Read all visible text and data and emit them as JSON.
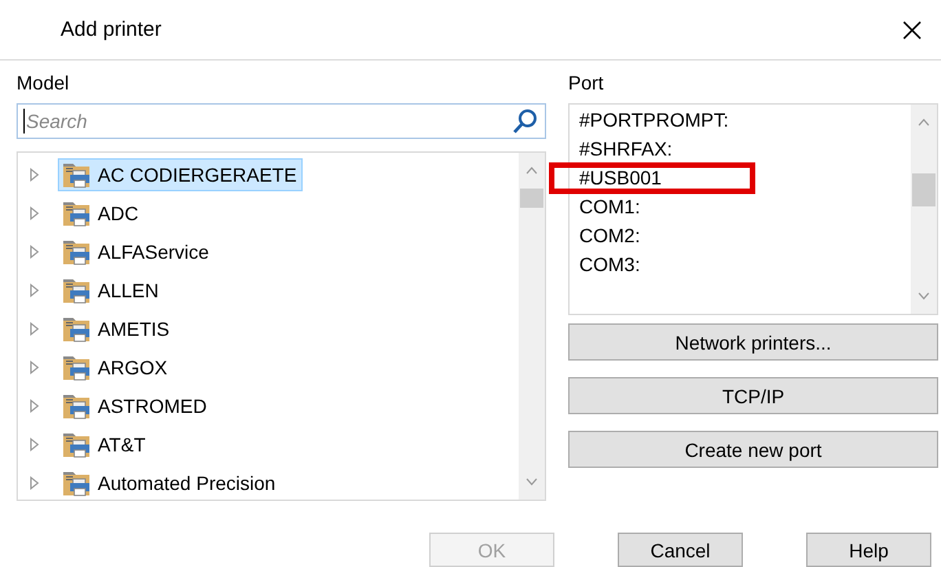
{
  "window": {
    "title": "Add printer"
  },
  "model": {
    "label": "Model",
    "search": {
      "placeholder": "Search"
    },
    "items": [
      {
        "label": "AC CODIERGERAETE",
        "selected": true,
        "expanded": false
      },
      {
        "label": "ADC",
        "selected": false,
        "expanded": false
      },
      {
        "label": "ALFAService",
        "selected": false,
        "expanded": false
      },
      {
        "label": "ALLEN",
        "selected": false,
        "expanded": false
      },
      {
        "label": "AMETIS",
        "selected": false,
        "expanded": false
      },
      {
        "label": "ARGOX",
        "selected": false,
        "expanded": false
      },
      {
        "label": "ASTROMED",
        "selected": false,
        "expanded": false
      },
      {
        "label": "AT&T",
        "selected": false,
        "expanded": false
      },
      {
        "label": "Automated Precision",
        "selected": false,
        "expanded": false
      }
    ]
  },
  "port": {
    "label": "Port",
    "items": [
      {
        "label": "#PORTPROMPT:",
        "highlighted": false
      },
      {
        "label": "#SHRFAX:",
        "highlighted": false
      },
      {
        "label": "#USB001",
        "highlighted": true
      },
      {
        "label": "COM1:",
        "highlighted": false
      },
      {
        "label": "COM2:",
        "highlighted": false
      },
      {
        "label": "COM3:",
        "highlighted": false
      }
    ],
    "buttons": [
      {
        "label": "Network printers..."
      },
      {
        "label": "TCP/IP"
      },
      {
        "label": "Create new port"
      }
    ]
  },
  "buttons": [
    {
      "label": "OK",
      "disabled": true
    },
    {
      "label": "Cancel",
      "disabled": false
    },
    {
      "label": "Help",
      "disabled": false
    }
  ]
}
